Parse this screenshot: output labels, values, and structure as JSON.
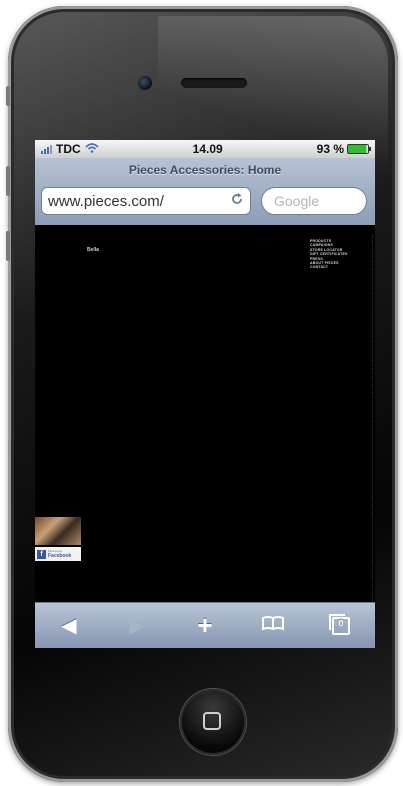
{
  "status_bar": {
    "carrier": "TDC",
    "time": "14.09",
    "battery": "93 %",
    "signal_icon": "signal-bars-icon",
    "wifi_icon": "wifi-icon",
    "battery_icon": "battery-icon"
  },
  "browser": {
    "page_title": "Pieces Accessories: Home",
    "url": "www.pieces.com/",
    "search_placeholder": "Google",
    "reload_icon": "reload-icon"
  },
  "page": {
    "brand_text": "Bella",
    "nav_items": [
      "PRODUCTS",
      "CAMPAIGNS",
      "STORE LOCATOR",
      "GIFT CERTIFICATES",
      "PRESS",
      "ABOUT PIECES",
      "CONTACT"
    ],
    "facebook": {
      "small": "Find us on",
      "label": "Facebook"
    }
  },
  "toolbar": {
    "back_icon": "back-arrow-icon",
    "forward_icon": "forward-arrow-icon",
    "add_icon": "plus-icon",
    "bookmarks_icon": "bookmarks-icon",
    "tabs_icon": "tabs-icon",
    "tabs_count": "0"
  },
  "colors": {
    "toolbar": "#8c9db7",
    "facebook": "#3b5998",
    "battery": "#2fbe2f"
  }
}
